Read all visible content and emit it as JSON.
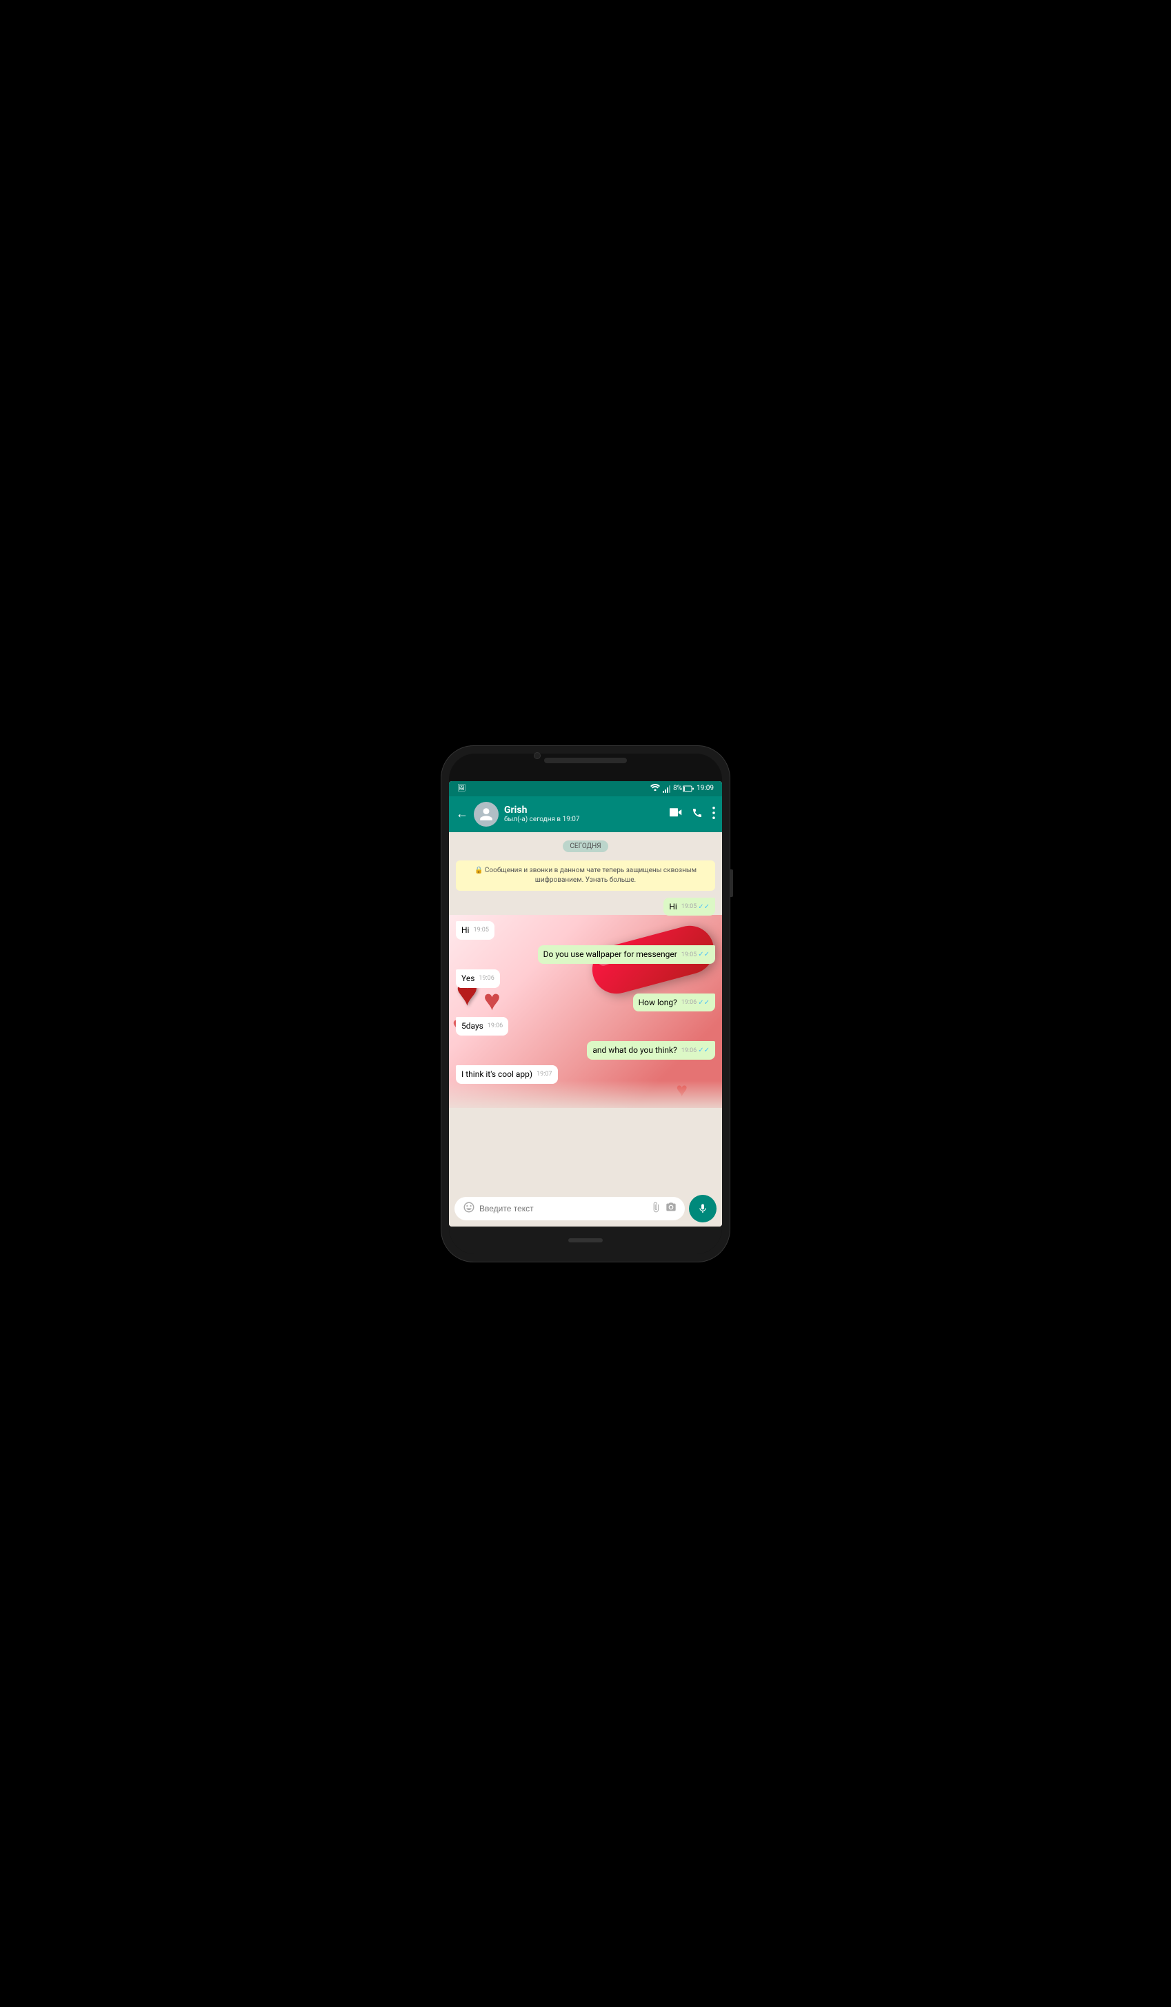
{
  "status_bar": {
    "wifi": "wifi",
    "signal": "signal",
    "battery": "8%",
    "time": "19:09"
  },
  "header": {
    "back_label": "←",
    "contact_name": "Grish",
    "contact_status": "был(-а) сегодня в 19:07",
    "video_icon": "video-camera",
    "call_icon": "phone",
    "more_icon": "more-vertical"
  },
  "chat": {
    "date_label": "СЕГОДНЯ",
    "encryption_notice": "🔒 Сообщения и звонки в данном чате теперь защищены сквозным шифрованием. Узнать больше.",
    "messages": [
      {
        "id": 1,
        "type": "sent",
        "text": "Hi",
        "time": "19:05",
        "ticks": "✓✓"
      },
      {
        "id": 2,
        "type": "received",
        "text": "Hi",
        "time": "19:05"
      },
      {
        "id": 3,
        "type": "sent",
        "text": "Do you use wallpaper for messenger",
        "time": "19:05",
        "ticks": "✓✓"
      },
      {
        "id": 4,
        "type": "received",
        "text": "Yes",
        "time": "19:06"
      },
      {
        "id": 5,
        "type": "sent",
        "text": "How long?",
        "time": "19:06",
        "ticks": "✓✓"
      },
      {
        "id": 6,
        "type": "received",
        "text": "5days",
        "time": "19:06"
      },
      {
        "id": 7,
        "type": "sent",
        "text": "and what do you think?",
        "time": "19:06",
        "ticks": "✓✓"
      },
      {
        "id": 8,
        "type": "received",
        "text": "I think it's cool app)",
        "time": "19:07"
      }
    ]
  },
  "input": {
    "placeholder": "Введите текст",
    "emoji_icon": "emoji",
    "attach_icon": "paperclip",
    "camera_icon": "camera",
    "mic_icon": "microphone"
  }
}
